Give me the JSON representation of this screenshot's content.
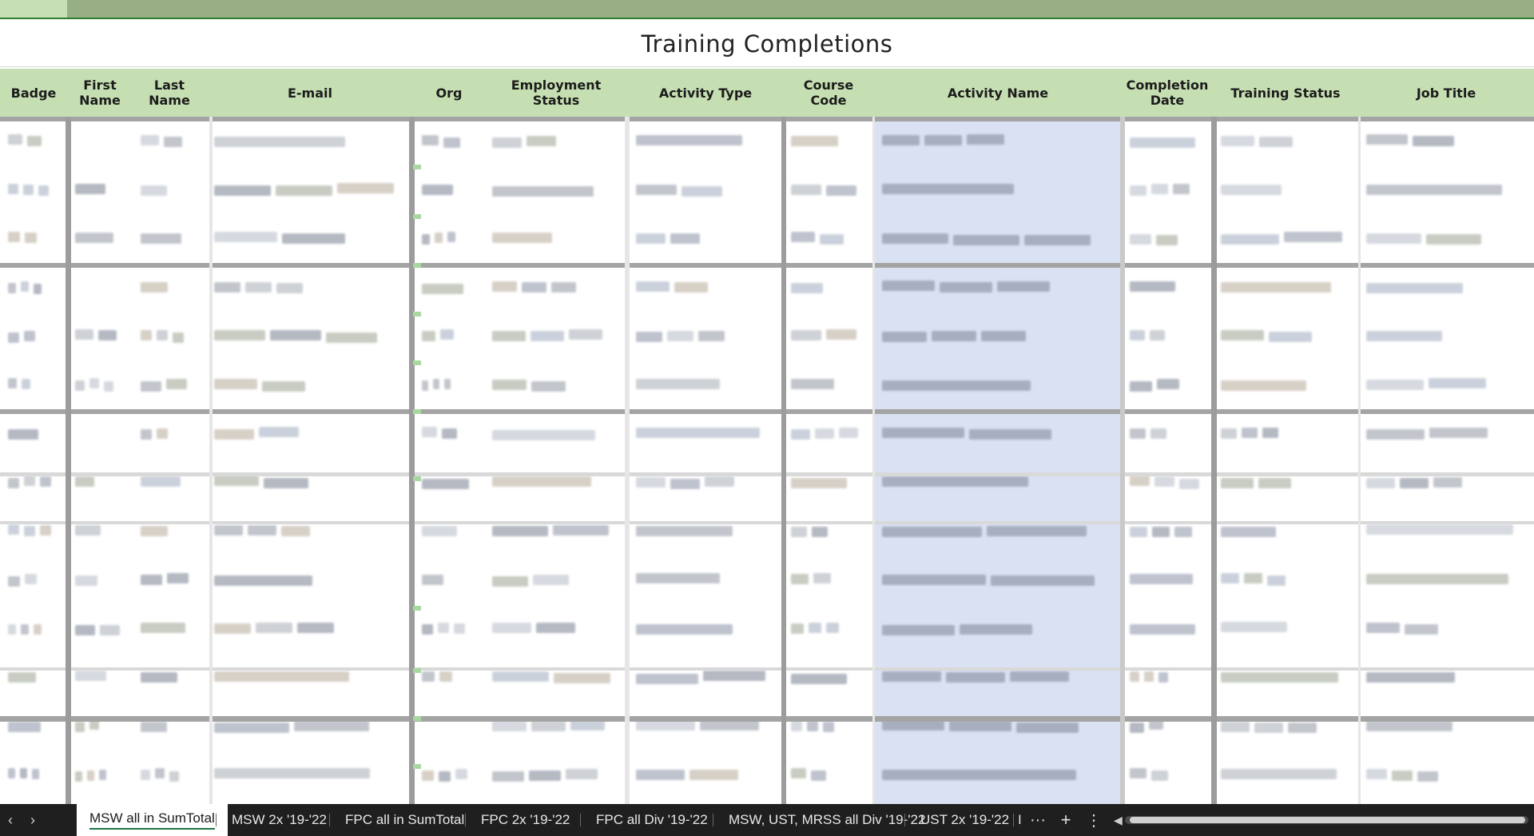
{
  "sheet": {
    "title": "Training Completions",
    "columns": [
      {
        "key": "badge",
        "label": "Badge"
      },
      {
        "key": "first",
        "label": "First\nName"
      },
      {
        "key": "last",
        "label": "Last\nName"
      },
      {
        "key": "email",
        "label": "E-mail"
      },
      {
        "key": "org",
        "label": "Org"
      },
      {
        "key": "emp",
        "label": "Employment\nStatus"
      },
      {
        "key": "atype",
        "label": "Activity Type"
      },
      {
        "key": "code",
        "label": "Course\nCode"
      },
      {
        "key": "aname",
        "label": "Activity Name"
      },
      {
        "key": "cdate",
        "label": "Completion\nDate"
      },
      {
        "key": "tstatus",
        "label": "Training Status"
      },
      {
        "key": "jtitle",
        "label": "Job Title"
      }
    ],
    "row_count": 14,
    "highlight_color": "#d9e1f2",
    "header_color": "#c6dfb2"
  },
  "tabs": {
    "nav_prev": "‹",
    "nav_next": "›",
    "items": [
      {
        "label": "MSW all in SumTotal",
        "active": true
      },
      {
        "label": "MSW 2x '19-'22",
        "active": false
      },
      {
        "label": "FPC all in SumTotal",
        "active": false
      },
      {
        "label": "FPC 2x '19-'22",
        "active": false
      },
      {
        "label": "FPC all Div '19-'22",
        "active": false
      },
      {
        "label": "MSW, UST, MRSS all Div '19-'22",
        "active": false
      },
      {
        "label": "UST 2x '19-'22",
        "active": false
      },
      {
        "label": "I",
        "active": false
      }
    ],
    "more_label": "···",
    "add_label": "+",
    "options_label": "⋮"
  }
}
